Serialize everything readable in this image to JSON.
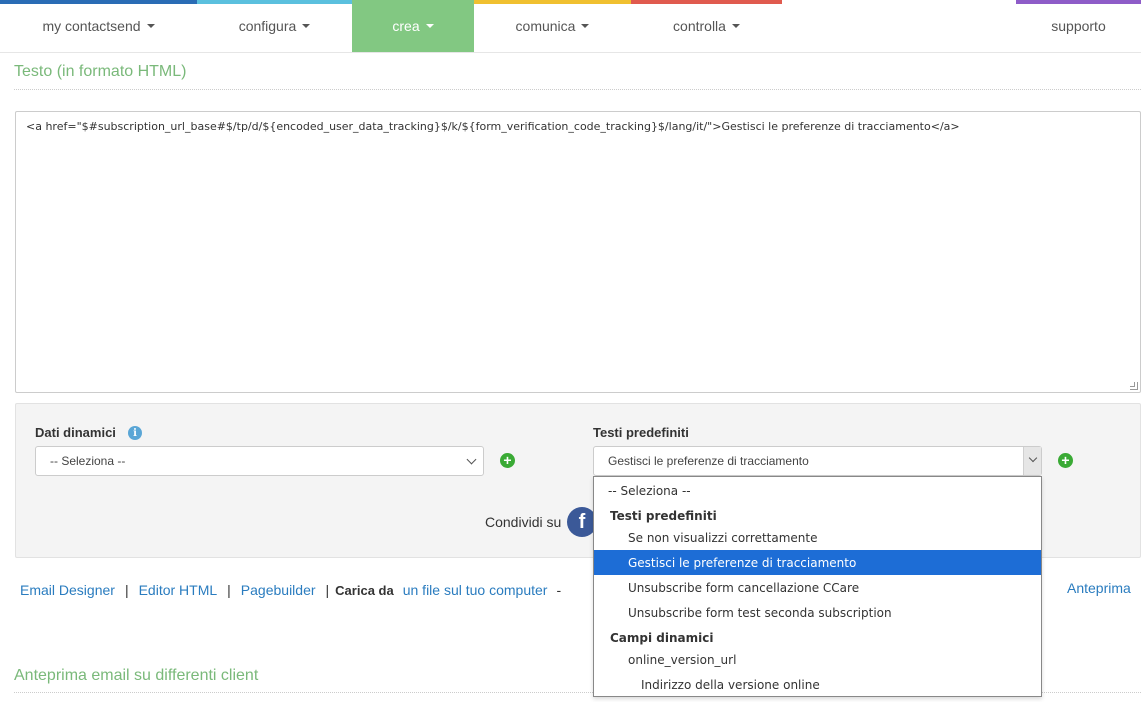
{
  "nav": {
    "items": [
      {
        "label": "my contactsend",
        "caret": true,
        "color": "#2a6cb5"
      },
      {
        "label": "configura",
        "caret": true,
        "color": "#5bc0de"
      },
      {
        "label": "crea",
        "caret": true,
        "color": "#82c882",
        "active": true
      },
      {
        "label": "comunica",
        "caret": true,
        "color": "#f0c030"
      },
      {
        "label": "controlla",
        "caret": true,
        "color": "#e05a4e"
      },
      {
        "label": "supporto",
        "caret": false,
        "color": "#8e5cc8"
      }
    ]
  },
  "editor": {
    "title": "Testo (in formato HTML)",
    "content": "<a href=\"$#subscription_url_base#$/tp/d/${encoded_user_data_tracking}$/k/${form_verification_code_tracking}$/lang/it/\">Gestisci le preferenze di tracciamento</a>"
  },
  "panel": {
    "dynamic_label": "Dati dinamici",
    "dynamic_select_value": "-- Seleziona --",
    "predefined_label": "Testi predefiniti",
    "predefined_select_value": "Gestisci le preferenze di tracciamento",
    "share_label": "Condividi su",
    "info_icon": "i",
    "fb_icon": "f",
    "plus_icon": "+"
  },
  "links": {
    "email_designer": "Email Designer",
    "editor_html": "Editor HTML",
    "pagebuilder": "Pagebuilder",
    "sep": "|",
    "carica_da": "Carica da",
    "file_link": "un file sul tuo computer",
    "dash": "-",
    "anteprima": "Anteprima"
  },
  "preview_title": "Anteprima email su differenti client",
  "dropdown": {
    "options": [
      {
        "label": "-- Seleziona --",
        "kind": "top"
      },
      {
        "label": "Testi predefiniti",
        "kind": "group"
      },
      {
        "label": "Se non visualizzi correttamente",
        "kind": "l1"
      },
      {
        "label": "Gestisci le preferenze di tracciamento",
        "kind": "l1",
        "selected": true
      },
      {
        "label": "Unsubscribe form cancellazione CCare",
        "kind": "l1"
      },
      {
        "label": "Unsubscribe form test seconda subscription",
        "kind": "l1"
      },
      {
        "label": "Campi dinamici",
        "kind": "group"
      },
      {
        "label": "online_version_url",
        "kind": "l1"
      },
      {
        "label": "Indirizzo della versione online",
        "kind": "l2"
      }
    ]
  },
  "colors": {
    "accent_green": "#82c882",
    "title_green": "#7ab97a",
    "link_blue": "#2a7cbf",
    "selected_blue": "#1d6dd6",
    "plus_green": "#3aaa35",
    "facebook_blue": "#3b5998"
  }
}
